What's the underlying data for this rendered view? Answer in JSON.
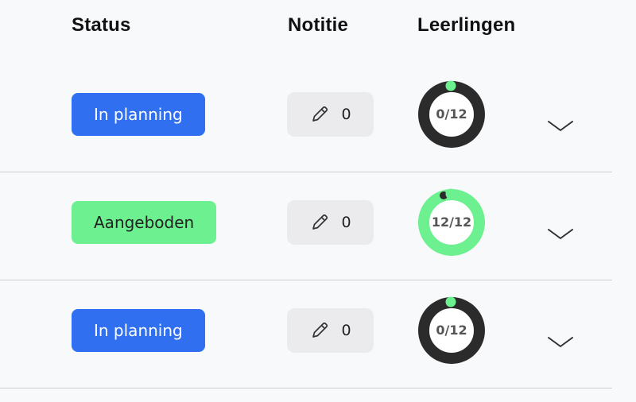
{
  "header": {
    "status": "Status",
    "note": "Notitie",
    "students": "Leerlingen"
  },
  "rows": [
    {
      "status_label": "In planning",
      "status_color": "#2f6ff0",
      "status_text_color": "#ffffff",
      "note_icon": "pencil-icon",
      "note_count": "0",
      "students_label": "0/12",
      "students_progress": 0,
      "ring_color": "#2b2b2b",
      "expand_icon": "chevron-down-icon"
    },
    {
      "status_label": "Aangeboden",
      "status_color": "#6df08f",
      "status_text_color": "#222222",
      "note_icon": "pencil-icon",
      "note_count": "0",
      "students_label": "12/12",
      "students_progress": 1,
      "ring_color": "#6df08f",
      "expand_icon": "chevron-down-icon"
    },
    {
      "status_label": "In planning",
      "status_color": "#2f6ff0",
      "status_text_color": "#ffffff",
      "note_icon": "pencil-icon",
      "note_count": "0",
      "students_label": "0/12",
      "students_progress": 0,
      "ring_color": "#2b2b2b",
      "expand_icon": "chevron-down-icon"
    }
  ],
  "colors": {
    "accent_green": "#6df08f",
    "ring_track": "#2b2b2b"
  }
}
